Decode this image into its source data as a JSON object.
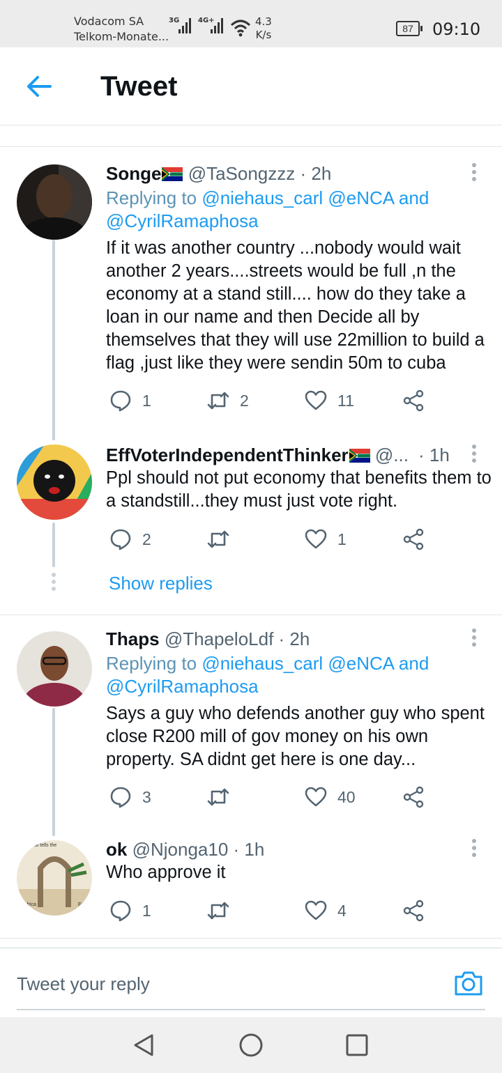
{
  "status_bar": {
    "carrier_1": "Vodacom SA",
    "carrier_2": "Telkom-Monate...",
    "net_1": "3G",
    "net_2": "4G+",
    "speed_value": "4.3",
    "speed_unit": "K/s",
    "battery": "87",
    "time": "09:10"
  },
  "header": {
    "title": "Tweet"
  },
  "tweets": [
    {
      "name": "Songe",
      "handle": "@TaSongzzz",
      "time": "· 2h",
      "replying_prefix": "Replying to",
      "replying_links": "@niehaus_carl @eNCA",
      "replying_and": "and",
      "replying_link2": "@CyrilRamaphosa",
      "text": "If it was another country ...nobody would wait another 2 years....streets would be full ,n the economy at a stand still.... how do they take a loan in our name and then Decide all by themselves that they will use 22million to build a  flag ,just like they were sendin 50m to cuba",
      "replies": "1",
      "retweets": "2",
      "likes": "11"
    },
    {
      "name": "EffVoterIndependentThinker",
      "handle": "@...",
      "time": "· 1h",
      "text": "Ppl should not put economy that benefits them to a standstill...they must just vote right.",
      "replies": "2",
      "retweets": "",
      "likes": "1"
    },
    {
      "name": "Thaps",
      "handle": "@ThapeloLdf",
      "time": "· 2h",
      "replying_prefix": "Replying to",
      "replying_links": "@niehaus_carl @eNCA",
      "replying_and": "and",
      "replying_link2": "@CyrilRamaphosa",
      "text": "Says a guy who defends another guy who spent close R200 mill of gov money on his own property. SA didnt get here is one day...",
      "replies": "3",
      "retweets": "",
      "likes": "40"
    },
    {
      "name": "ok",
      "handle": "@Njonga10",
      "time": "· 1h",
      "text": "Who approve it",
      "replies": "1",
      "retweets": "",
      "likes": "4",
      "avatar_caption": "cture that tells the",
      "avatar_left": "Africa",
      "avatar_right": "Eu"
    }
  ],
  "show_replies": "Show replies",
  "composer": {
    "placeholder": "Tweet your reply"
  },
  "colors": {
    "link": "#1d9bf0",
    "secondary": "#536471",
    "text": "#0f1419"
  },
  "icons": [
    "back-arrow-icon",
    "more-icon",
    "reply-icon",
    "retweet-icon",
    "like-icon",
    "share-icon",
    "camera-icon",
    "nav-back-icon",
    "nav-home-icon",
    "nav-recents-icon",
    "south-africa-flag-icon"
  ]
}
